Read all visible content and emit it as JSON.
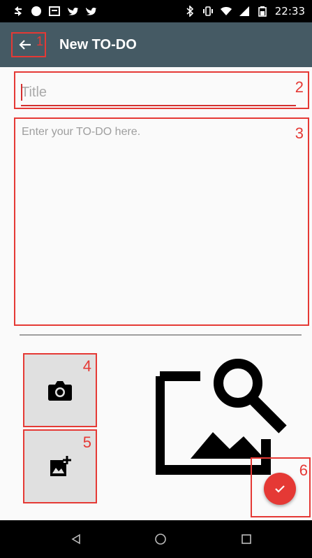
{
  "status_bar": {
    "icons": [
      "notification-arrows-icon",
      "notification-dot-icon",
      "notification-box-icon",
      "twitter-icon",
      "twitter-icon",
      "bluetooth-icon",
      "vibrate-icon",
      "wifi-icon",
      "signal-icon",
      "battery-icon"
    ],
    "time": "22:33"
  },
  "app_bar": {
    "back_icon": "arrow-left-icon",
    "title": "New TO-DO"
  },
  "form": {
    "title_placeholder": "Title",
    "body_placeholder": "Enter your TO-DO here."
  },
  "media": {
    "camera_icon": "camera-icon",
    "add_image_icon": "add-photo-icon",
    "preview_icon": "image-search-icon"
  },
  "fab": {
    "icon": "check-icon"
  },
  "annotations": [
    "1",
    "2",
    "3",
    "4",
    "5",
    "6"
  ],
  "nav_bar": {
    "icons": [
      "back-triangle-icon",
      "home-circle-icon",
      "recents-square-icon"
    ]
  },
  "colors": {
    "app_bar": "#455a64",
    "accent": "#e53935",
    "annotation": "#e53935",
    "background": "#fafafa"
  }
}
